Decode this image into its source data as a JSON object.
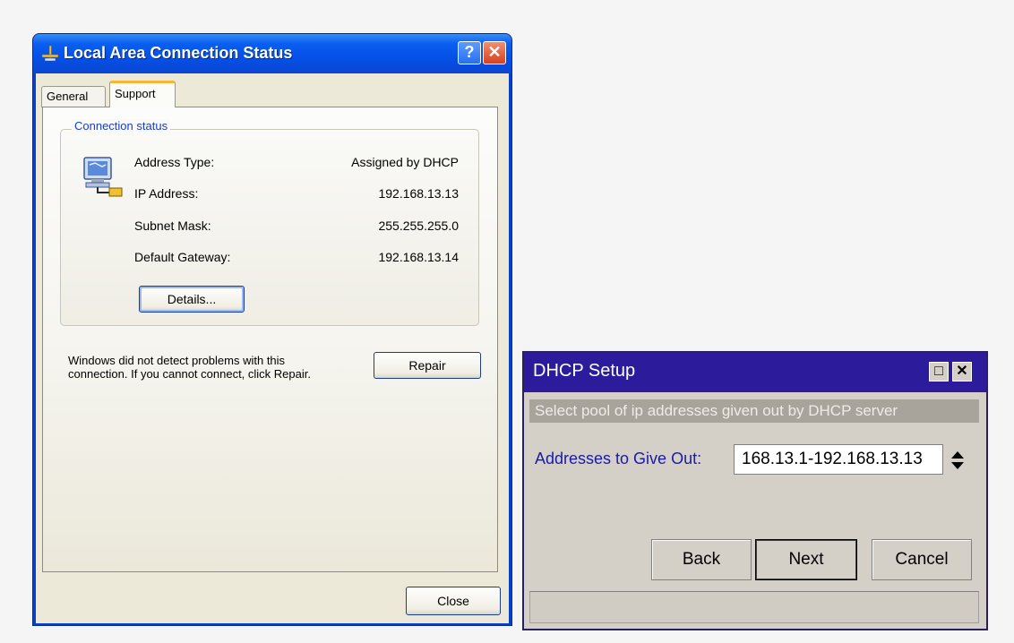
{
  "lan_dialog": {
    "title": "Local Area Connection Status",
    "help_button": "?",
    "close_button": "✕",
    "tabs": [
      {
        "label": "General"
      },
      {
        "label": "Support"
      }
    ],
    "group_title": "Connection status",
    "rows": [
      {
        "label": "Address Type:",
        "value": "Assigned by DHCP"
      },
      {
        "label": "IP Address:",
        "value": "192.168.13.13"
      },
      {
        "label": "Subnet Mask:",
        "value": "255.255.255.0"
      },
      {
        "label": "Default Gateway:",
        "value": "192.168.13.14"
      }
    ],
    "details_button": "Details...",
    "repair_text": "Windows did not detect problems with this connection. If you cannot connect, click Repair.",
    "repair_button": "Repair",
    "close_footer_button": "Close"
  },
  "dhcp_dialog": {
    "title": "DHCP Setup",
    "maximize_button": "□",
    "close_button": "✕",
    "banner": "Select pool of ip addresses given out by DHCP server",
    "field_label": "Addresses to Give Out:",
    "field_value": "168.13.1-192.168.13.13",
    "back_button": "Back",
    "next_button": "Next",
    "cancel_button": "Cancel"
  },
  "icons": [
    "network-connection-icon",
    "network-computer-icon",
    "spinner-arrows-icon"
  ],
  "colors": {
    "xp_title_blue": "#0a5ef0",
    "xp_client": "#ece9d8",
    "xp_tab_highlight": "#f5b63a",
    "dhcp_title": "#2c1c9c",
    "dhcp_label": "#1a1aa8",
    "dhcp_bg": "#d4d0c8"
  }
}
